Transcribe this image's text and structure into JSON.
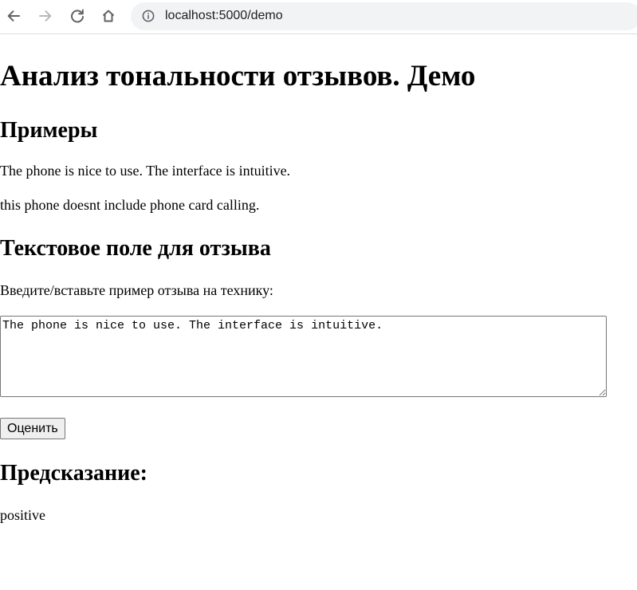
{
  "browser": {
    "url": "localhost:5000/demo",
    "icons": {
      "back": "arrow-left-icon",
      "forward": "arrow-right-icon",
      "reload": "reload-icon",
      "home": "home-icon",
      "site_info": "info-icon"
    }
  },
  "page": {
    "title": "Анализ тональности отзывов. Демо",
    "examples": {
      "heading": "Примеры",
      "items": [
        "The phone is nice to use. The interface is intuitive.",
        "this phone doesnt include phone card calling."
      ]
    },
    "review": {
      "heading": "Текстовое поле для отзыва",
      "prompt": "Введите/вставьте пример отзыва на технику:",
      "value": "The phone is nice to use. The interface is intuitive.",
      "submit_label": "Оценить"
    },
    "prediction": {
      "heading": "Предсказание:",
      "result": "positive"
    }
  }
}
